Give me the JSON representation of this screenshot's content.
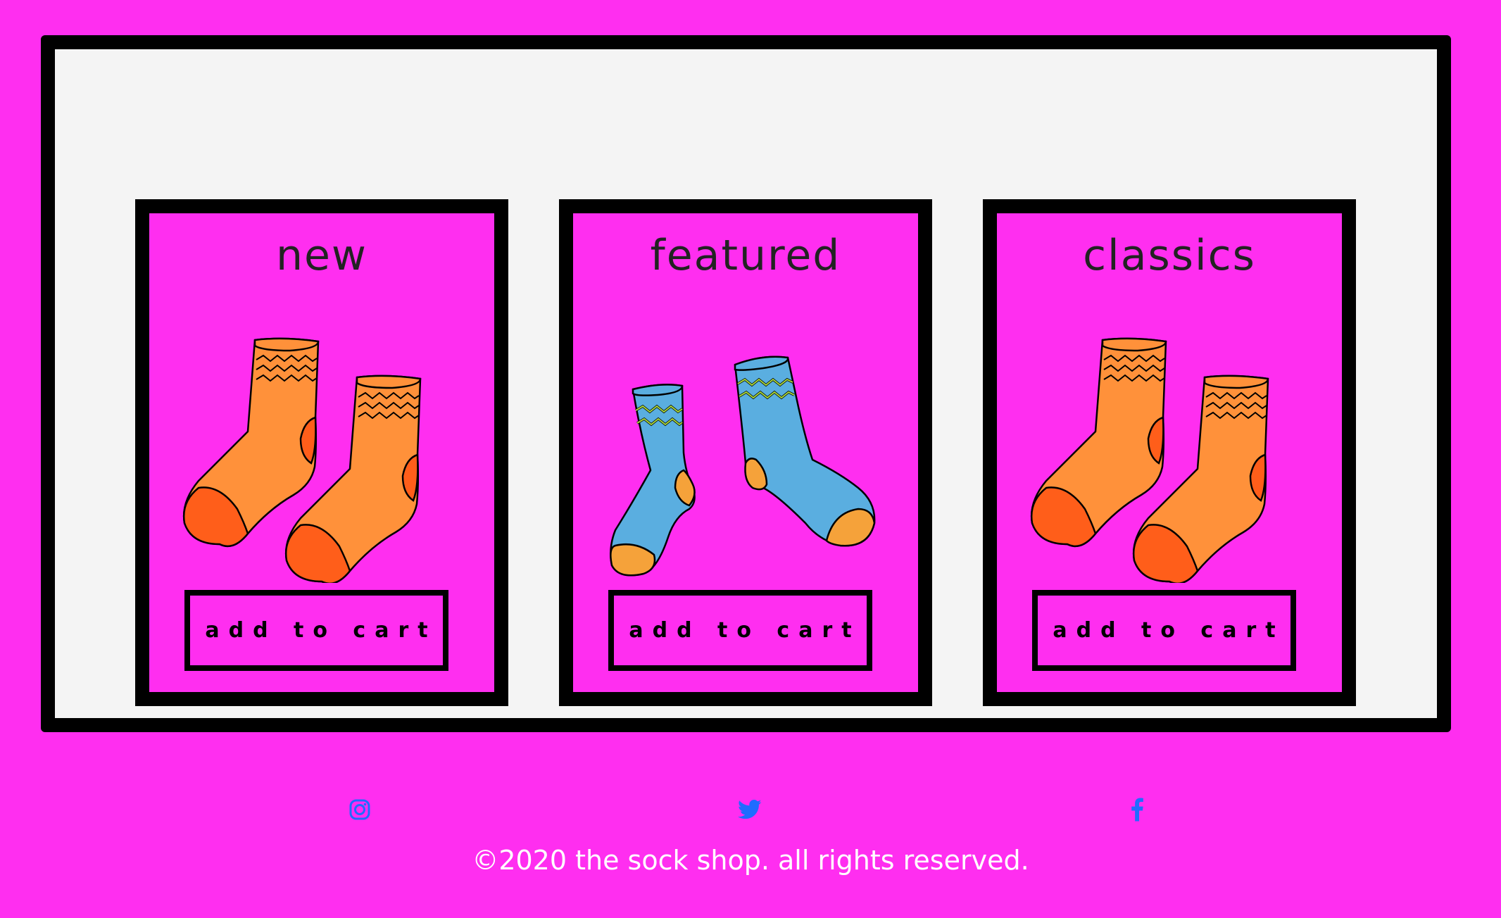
{
  "products": [
    {
      "title": "new",
      "button_label": "add to cart",
      "image": "orange-socks-pair"
    },
    {
      "title": "featured",
      "button_label": "add to cart",
      "image": "blue-socks-pair"
    },
    {
      "title": "classics",
      "button_label": "add to cart",
      "image": "orange-socks-pair"
    }
  ],
  "social": {
    "icons": [
      "instagram-icon",
      "twitter-icon",
      "facebook-icon"
    ],
    "icon_color": "#1f6cff"
  },
  "footer": {
    "copyright": "©2020 the sock shop. all rights reserved."
  },
  "colors": {
    "background": "#ff2ef0",
    "panel": "#f4f4f4",
    "border": "#000000",
    "sock_orange": "#ff913a",
    "sock_orange_dark": "#ff5e1a",
    "sock_blue": "#5aaee0",
    "stripe_green": "#a9d63a"
  }
}
